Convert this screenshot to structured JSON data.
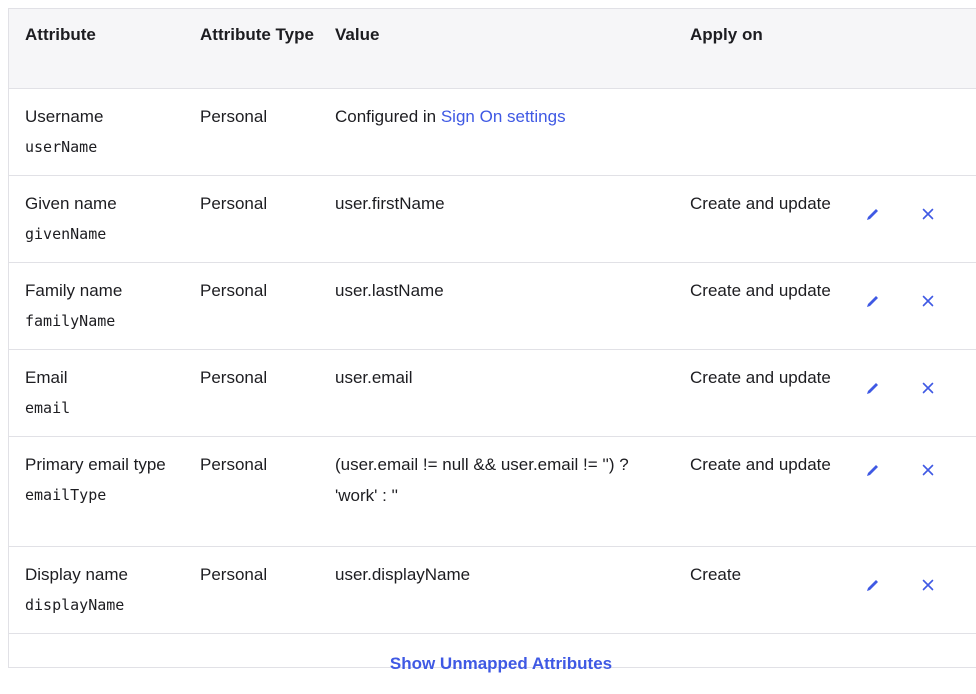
{
  "table": {
    "headers": {
      "attribute": "Attribute",
      "attribute_type": "Attribute Type",
      "value": "Value",
      "apply_on": "Apply on"
    },
    "rows": [
      {
        "name": "Username",
        "key": "userName",
        "type": "Personal",
        "value_prefix": "Configured in ",
        "value_link": "Sign On settings",
        "apply_on": "",
        "editable": false
      },
      {
        "name": "Given name",
        "key": "givenName",
        "type": "Personal",
        "value": "user.firstName",
        "apply_on": "Create and update",
        "editable": true
      },
      {
        "name": "Family name",
        "key": "familyName",
        "type": "Personal",
        "value": "user.lastName",
        "apply_on": "Create and update",
        "editable": true
      },
      {
        "name": "Email",
        "key": "email",
        "type": "Personal",
        "value": "user.email",
        "apply_on": "Create and update",
        "editable": true
      },
      {
        "name": "Primary email type",
        "key": "emailType",
        "type": "Personal",
        "value": "(user.email != null && user.email != '') ? 'work' : ''",
        "apply_on": "Create and update",
        "editable": true
      },
      {
        "name": "Display name",
        "key": "displayName",
        "type": "Personal",
        "value": "user.displayName",
        "apply_on": "Create",
        "editable": true
      }
    ]
  },
  "footer": {
    "show_unmapped_label": "Show Unmapped Attributes"
  },
  "icons": {
    "edit": "pencil-icon",
    "delete": "close-icon"
  },
  "colors": {
    "accent": "#3f59e4",
    "header_bg": "#f6f6f8",
    "border": "#e1e1e6",
    "text": "#1d1d21"
  }
}
